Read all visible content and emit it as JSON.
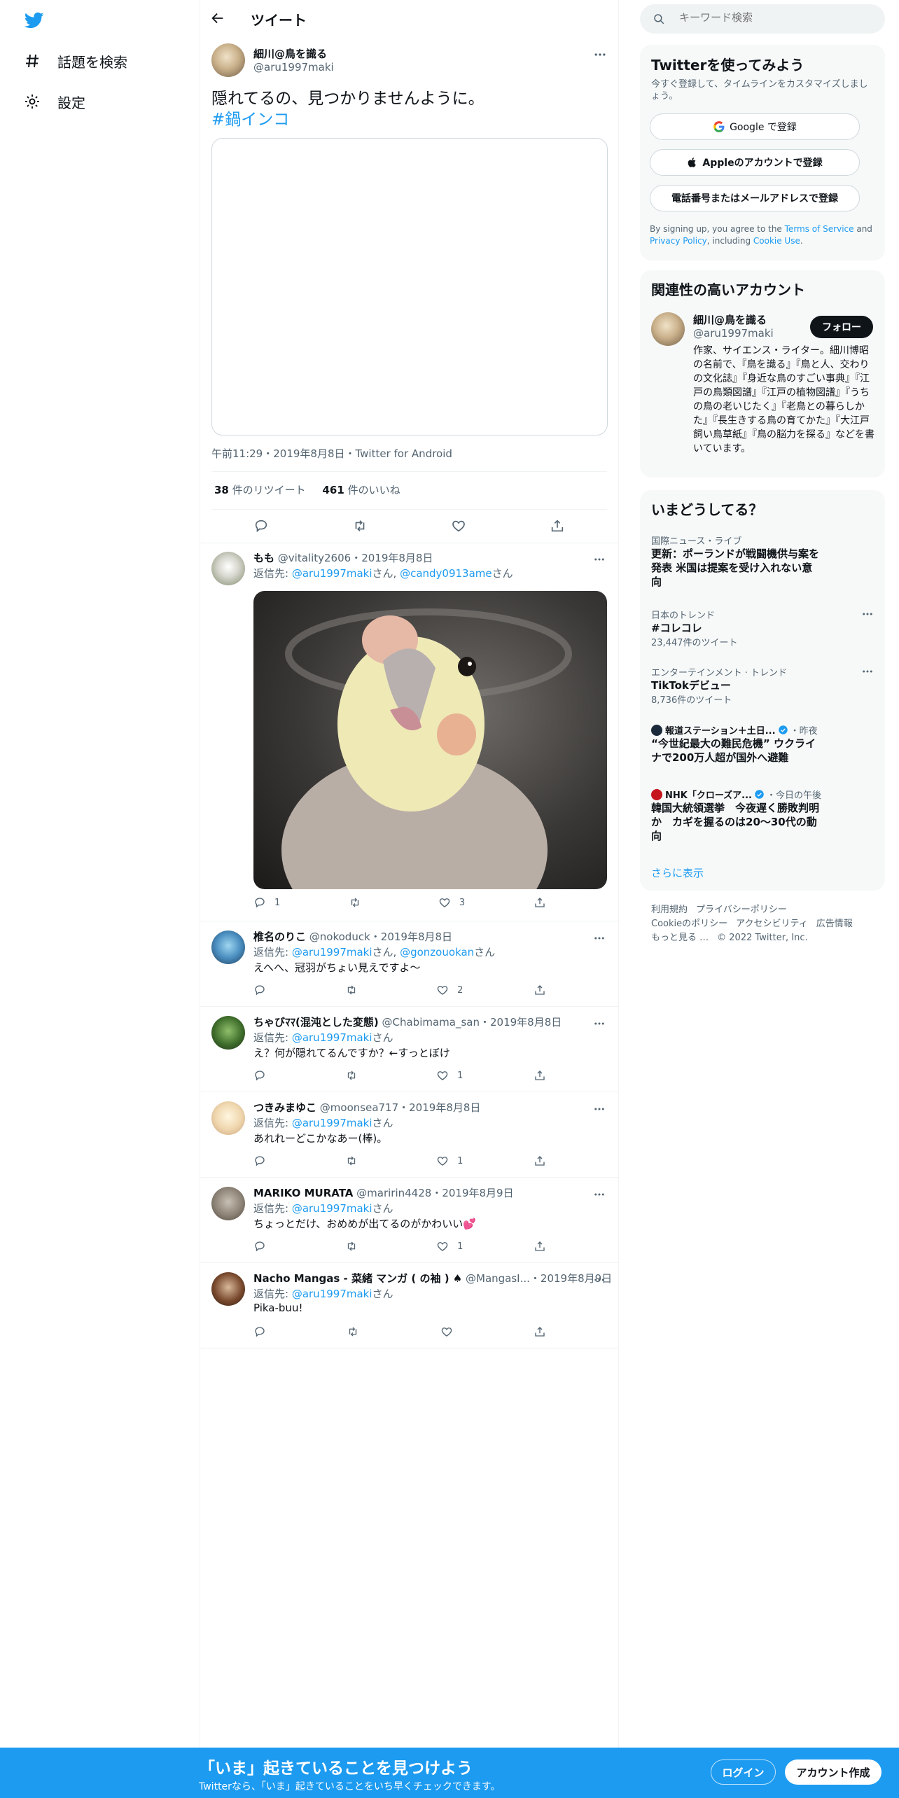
{
  "nav": {
    "items": [
      {
        "label": "話題を検索",
        "icon": "hashtag-icon"
      },
      {
        "label": "設定",
        "icon": "gear-icon"
      }
    ]
  },
  "header": {
    "title": "ツイート"
  },
  "tweet": {
    "display_name": "細川@鳥を識る",
    "handle": "@aru1997maki",
    "text": "隠れてるの、見つかりませんように。",
    "hashtag": "#鍋インコ",
    "meta": "午前11:29・2019年8月8日・Twitter for Android",
    "retweets_count": "38",
    "retweets_label": " 件のリツイート",
    "likes_count": "461",
    "likes_label": " 件のいいね"
  },
  "replies": [
    {
      "name": "もも",
      "handle": "@vitality2606",
      "date": "・2019年8月8日",
      "reply_prefix": "返信先: ",
      "reply_to": "@aru1997maki",
      "reply_mid": "さん, ",
      "reply_to2": "@candy0913ame",
      "reply_suffix": "さん",
      "text": "",
      "reply_count": "1",
      "retweet_count": "",
      "like_count": "3"
    },
    {
      "name": "椎名のりこ",
      "handle": "@nokoduck",
      "date": "・2019年8月8日",
      "reply_prefix": "返信先: ",
      "reply_to": "@aru1997maki",
      "reply_mid": "さん, ",
      "reply_to2": "@gonzouokan",
      "reply_suffix": "さん",
      "text": "えへへ、冠羽がちょい見えですよ～",
      "reply_count": "",
      "retweet_count": "",
      "like_count": "2"
    },
    {
      "name": "ちゃびﾏﾏ(混沌とした変態)",
      "handle": "@Chabimama_san",
      "date": "・2019年8月8日",
      "reply_prefix": "返信先: ",
      "reply_to": "@aru1997maki",
      "reply_suffix": "さん",
      "text": "え？何が隠れてるんですか？←すっとぼけ",
      "reply_count": "",
      "retweet_count": "",
      "like_count": "1"
    },
    {
      "name": "つきみまゆこ",
      "handle": "@moonsea717",
      "date": "・2019年8月8日",
      "reply_prefix": "返信先: ",
      "reply_to": "@aru1997maki",
      "reply_suffix": "さん",
      "text": "あれれーどこかなあー(棒)。",
      "reply_count": "",
      "retweet_count": "",
      "like_count": "1"
    },
    {
      "name": "MARIKO MURATA",
      "handle": "@maririn4428",
      "date": "・2019年8月9日",
      "reply_prefix": "返信先: ",
      "reply_to": "@aru1997maki",
      "reply_suffix": "さん",
      "text": "ちょっとだけ、おめめが出てるのがかわいい💕",
      "reply_count": "",
      "retweet_count": "",
      "like_count": "1"
    },
    {
      "name": "Nacho Mangas - 菜緒 マンガ ( の袖 ) ♠",
      "handle": "@MangasI...",
      "date": "・2019年8月9日",
      "reply_prefix": "返信先: ",
      "reply_to": "@aru1997maki",
      "reply_suffix": "さん",
      "text": "Pika-buu!",
      "reply_count": "",
      "retweet_count": "",
      "like_count": ""
    }
  ],
  "sidebar": {
    "search_placeholder": "キーワード検索",
    "signup": {
      "title": "Twitterを使ってみよう",
      "subtitle": "今すぐ登録して、タイムラインをカスタマイズしましょう。",
      "google": "Google で登録",
      "apple": "Appleのアカウントで登録",
      "phone": "電話番号またはメールアドレスで登録",
      "terms_prefix": "By signing up, you agree to the ",
      "terms": "Terms of Service",
      "and": " and ",
      "privacy": "Privacy Policy",
      "including": ", including ",
      "cookie": "Cookie Use",
      "period": "."
    },
    "related": {
      "title": "関連性の高いアカウント",
      "name": "細川@鳥を識る",
      "handle": "@aru1997maki",
      "follow": "フォロー",
      "bio": "作家、サイエンス・ライター。細川博昭の名前で、『鳥を識る』『鳥と人、交わりの文化誌』『身近な鳥のすごい事典』『江戸の鳥類図譜』『江戸の植物図譜』『うちの鳥の老いじたく』『老鳥との暮らしかた』『長生きする鳥の育てかた』『大江戸飼い鳥草紙』『鳥の脳力を探る』などを書いています。"
    },
    "trends": {
      "title": "いまどうしてる？",
      "items": [
        {
          "category": "国際ニュース・ライブ",
          "title": "更新：ポーランドが戦闘機供与案を発表 米国は提案を受け入れない意向",
          "count": ""
        },
        {
          "category": "日本のトレンド",
          "title": "#コレコレ",
          "count": "23,447件のツイート"
        },
        {
          "category": "エンターテインメント · トレンド",
          "title": "TikTokデビュー",
          "count": "8,736件のツイート"
        },
        {
          "category": "報道ステーション＋土日...",
          "category_suffix": "・昨夜",
          "title": "“今世紀最大の難民危機” ウクライナで200万人超が国外へ避難",
          "count": ""
        },
        {
          "category": "NHK「クローズア...",
          "category_suffix": "・今日の午後",
          "title": "韓国大統領選挙　今夜遅く勝敗判明か　カギを握るのは20～30代の動向",
          "count": ""
        }
      ],
      "more": "さらに表示"
    },
    "footer": {
      "links": [
        "利用規約",
        "プライバシーポリシー",
        "Cookieのポリシー",
        "アクセシビリティ",
        "広告情報",
        "もっと見る …"
      ],
      "copyright": "© 2022 Twitter, Inc."
    }
  },
  "bottombar": {
    "title": "「いま」起きていることを見つけよう",
    "subtitle": "Twitterなら、「いま」起きていることをいち早くチェックできます。",
    "login": "ログイン",
    "signup": "アカウント作成"
  },
  "colors": {
    "accent": "#1d9bf0",
    "text": "#0f1419",
    "muted": "#536471",
    "border": "#eff3f4"
  }
}
